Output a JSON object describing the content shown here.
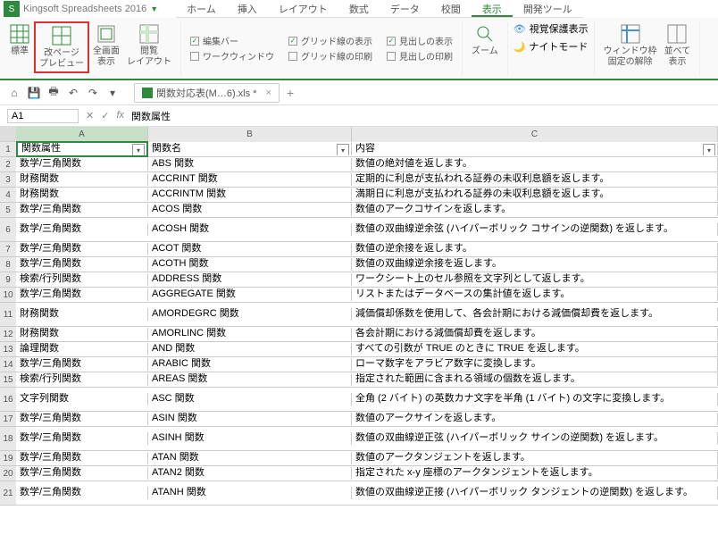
{
  "app": {
    "title": "Kingsoft Spreadsheets 2016"
  },
  "tabs": [
    "ホーム",
    "挿入",
    "レイアウト",
    "数式",
    "データ",
    "校閲",
    "表示",
    "開発ツール"
  ],
  "active_tab_index": 6,
  "ribbon": {
    "view_items": [
      {
        "label": "標準"
      },
      {
        "label": "改ページ\nプレビュー"
      },
      {
        "label": "全画面\n表示"
      },
      {
        "label": "閲覧\nレイアウト"
      }
    ],
    "checks1": [
      {
        "label": "編集バー",
        "checked": true
      },
      {
        "label": "ワークウィンドウ",
        "checked": false
      }
    ],
    "checks2": [
      {
        "label": "グリッド線の表示",
        "checked": true
      },
      {
        "label": "グリッド線の印刷",
        "checked": false
      }
    ],
    "checks3": [
      {
        "label": "見出しの表示",
        "checked": true
      },
      {
        "label": "見出しの印刷",
        "checked": false
      }
    ],
    "zoom_label": "ズーム",
    "vision_label": "視覚保護表示",
    "night_label": "ナイトモード",
    "freeze_label": "ウィンドウ枠\n固定の解除",
    "arrange_label": "並べて\n表示"
  },
  "file_tab": "関数対応表(M…6).xls *",
  "cell_ref": "A1",
  "fx_symbol": "fx",
  "formula": "関数属性",
  "columns": [
    "A",
    "B",
    "C"
  ],
  "headers": {
    "A": "関数属性",
    "B": "関数名",
    "C": "内容"
  },
  "rows": [
    {
      "r": 2,
      "tall": false,
      "a": "数学/三角関数",
      "b": "ABS 関数",
      "c": "数値の絶対値を返します。"
    },
    {
      "r": 3,
      "tall": false,
      "a": "財務関数",
      "b": "ACCRINT 関数",
      "c": "定期的に利息が支払われる証券の未収利息額を返します。"
    },
    {
      "r": 4,
      "tall": false,
      "a": "財務関数",
      "b": "ACCRINTM 関数",
      "c": "満期日に利息が支払われる証券の未収利息額を返します。"
    },
    {
      "r": 5,
      "tall": false,
      "a": "数学/三角関数",
      "b": "ACOS 関数",
      "c": "数値のアークコサインを返します。"
    },
    {
      "r": 6,
      "tall": true,
      "a": "数学/三角関数",
      "b": "ACOSH 関数",
      "c": "数値の双曲線逆余弦 (ハイパーボリック コサインの逆関数) を返します。"
    },
    {
      "r": 7,
      "tall": false,
      "a": "数学/三角関数",
      "b": "ACOT 関数",
      "c": "数値の逆余接を返します。"
    },
    {
      "r": 8,
      "tall": false,
      "a": "数学/三角関数",
      "b": "ACOTH 関数",
      "c": "数値の双曲線逆余接を返します。"
    },
    {
      "r": 9,
      "tall": false,
      "a": "検索/行列関数",
      "b": "ADDRESS 関数",
      "c": "ワークシート上のセル参照を文字列として返します。"
    },
    {
      "r": 10,
      "tall": false,
      "a": "数学/三角関数",
      "b": "AGGREGATE 関数",
      "c": "リストまたはデータベースの集計値を返します。"
    },
    {
      "r": 11,
      "tall": true,
      "a": "財務関数",
      "b": "AMORDEGRC 関数",
      "c": "減価償却係数を使用して、各会計期における減価償却費を返します。"
    },
    {
      "r": 12,
      "tall": false,
      "a": "財務関数",
      "b": "AMORLINC 関数",
      "c": "各会計期における減価償却費を返します。"
    },
    {
      "r": 13,
      "tall": false,
      "a": "論理関数",
      "b": "AND 関数",
      "c": "すべての引数が TRUE のときに TRUE を返します。"
    },
    {
      "r": 14,
      "tall": false,
      "a": "数学/三角関数",
      "b": "ARABIC 関数",
      "c": "ローマ数字をアラビア数字に変換します。"
    },
    {
      "r": 15,
      "tall": false,
      "a": "検索/行列関数",
      "b": "AREAS 関数",
      "c": "指定された範囲に含まれる領域の個数を返します。"
    },
    {
      "r": 16,
      "tall": true,
      "a": "文字列関数",
      "b": "ASC 関数",
      "c": "全角 (2 バイト) の英数カナ文字を半角 (1 バイト) の文字に変換します。"
    },
    {
      "r": 17,
      "tall": false,
      "a": "数学/三角関数",
      "b": "ASIN 関数",
      "c": "数値のアークサインを返します。"
    },
    {
      "r": 18,
      "tall": true,
      "a": "数学/三角関数",
      "b": "ASINH 関数",
      "c": "数値の双曲線逆正弦 (ハイパーボリック サインの逆関数) を返します。"
    },
    {
      "r": 19,
      "tall": false,
      "a": "数学/三角関数",
      "b": "ATAN 関数",
      "c": "数値のアークタンジェントを返します。"
    },
    {
      "r": 20,
      "tall": false,
      "a": "数学/三角関数",
      "b": "ATAN2 関数",
      "c": "指定された x-y 座標のアークタンジェントを返します。"
    },
    {
      "r": 21,
      "tall": true,
      "a": "数学/三角関数",
      "b": "ATANH 関数",
      "c": "数値の双曲線逆正接 (ハイパーボリック タンジェントの逆関数) を返します。"
    }
  ]
}
